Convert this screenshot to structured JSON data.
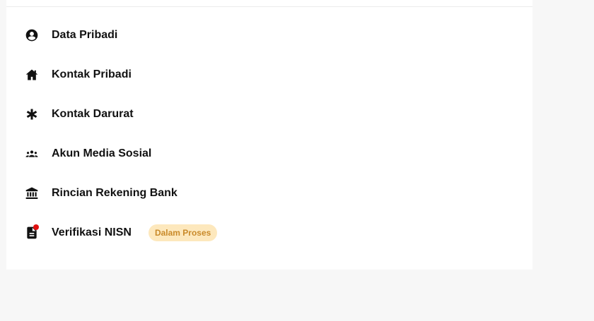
{
  "menu": {
    "items": [
      {
        "label": "Data Pribadi",
        "icon": "account-circle-icon"
      },
      {
        "label": "Kontak Pribadi",
        "icon": "home-icon"
      },
      {
        "label": "Kontak Darurat",
        "icon": "asterisk-icon"
      },
      {
        "label": "Akun Media Sosial",
        "icon": "people-group-icon"
      },
      {
        "label": "Rincian Rekening Bank",
        "icon": "bank-icon"
      },
      {
        "label": "Verifikasi NISN",
        "icon": "document-icon",
        "badge": "Dalam Proses",
        "has_notification": true
      }
    ]
  },
  "colors": {
    "badge_bg": "#fde8bd",
    "badge_text": "#c98a2a",
    "notification_dot": "#e01010",
    "icon": "#111111"
  }
}
